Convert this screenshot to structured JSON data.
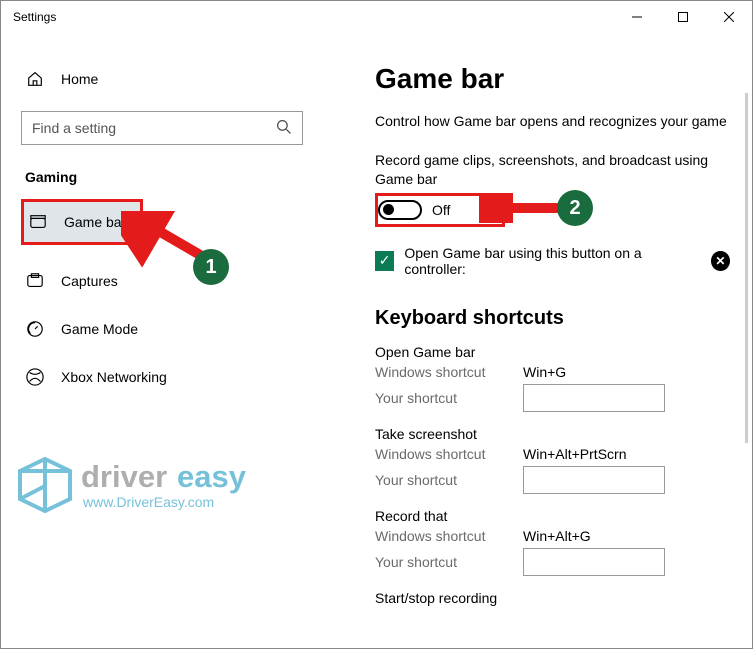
{
  "window_title": "Settings",
  "sidebar": {
    "home_label": "Home",
    "search_placeholder": "Find a setting",
    "category": "Gaming",
    "items": [
      {
        "label": "Game bar",
        "name": "gamebar",
        "selected": true
      },
      {
        "label": "Captures",
        "name": "captures",
        "selected": false
      },
      {
        "label": "Game Mode",
        "name": "game-mode",
        "selected": false
      },
      {
        "label": "Xbox Networking",
        "name": "xbox-networking",
        "selected": false
      }
    ]
  },
  "main": {
    "heading": "Game bar",
    "description": "Control how Game bar opens and recognizes your game",
    "record_description": "Record game clips, screenshots, and broadcast using Game bar",
    "toggle_state_label": "Off",
    "checkbox_label": "Open Game bar using this button on a controller:",
    "shortcuts_heading": "Keyboard shortcuts",
    "shortcuts": [
      {
        "title": "Open Game bar",
        "win_label": "Windows shortcut",
        "win_value": "Win+G",
        "your_label": "Your shortcut",
        "your_value": ""
      },
      {
        "title": "Take screenshot",
        "win_label": "Windows shortcut",
        "win_value": "Win+Alt+PrtScrn",
        "your_label": "Your shortcut",
        "your_value": ""
      },
      {
        "title": "Record that",
        "win_label": "Windows shortcut",
        "win_value": "Win+Alt+G",
        "your_label": "Your shortcut",
        "your_value": ""
      },
      {
        "title": "Start/stop recording",
        "win_label": "",
        "win_value": "",
        "your_label": "",
        "your_value": ""
      }
    ]
  },
  "annotations": {
    "step1": "1",
    "step2": "2"
  },
  "watermark": {
    "line1": "driver easy",
    "line2": "www.DriverEasy.com"
  }
}
